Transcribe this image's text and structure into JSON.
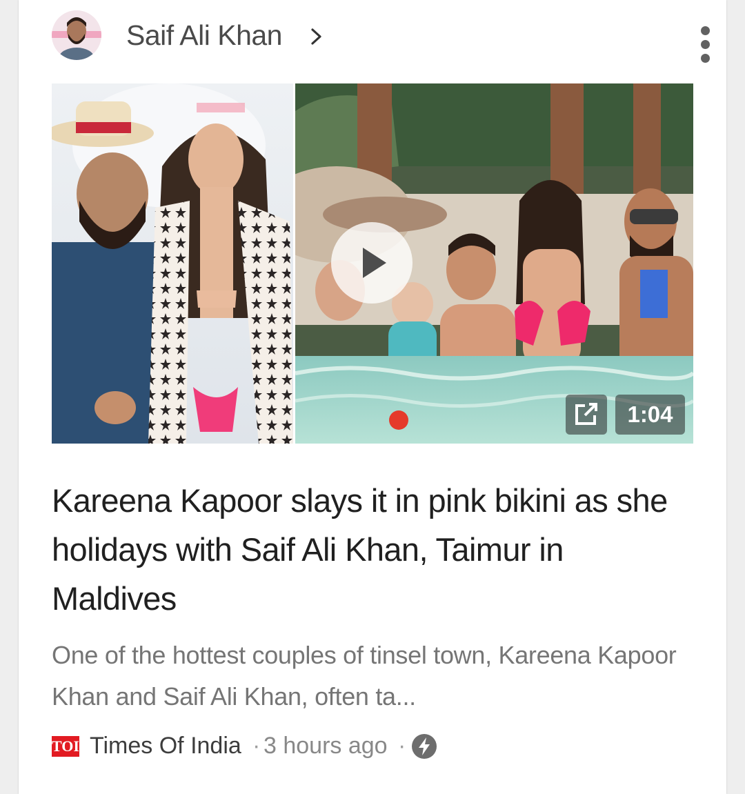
{
  "topic": {
    "name": "Saif Ali Khan"
  },
  "story": {
    "headline": "Kareena Kapoor slays it in pink bikini as she holidays with Saif Ali Khan, Taimur in Maldives",
    "snippet": "One of the hottest couples of tinsel town, Kareena Kapoor Khan and Saif Ali Khan, often ta...",
    "video_duration": "1:04"
  },
  "source": {
    "logo_text": "TOI",
    "name": "Times Of India",
    "separator": "·",
    "time": "3 hours ago"
  },
  "icons": {
    "chevron": "chevron-right-icon",
    "menu": "more-vert-icon",
    "play": "play-icon",
    "open": "open-in-new-icon",
    "amp": "amp-bolt-icon"
  },
  "colors": {
    "toi_red": "#e21b22",
    "headline": "#202020",
    "snippet": "#757575"
  }
}
